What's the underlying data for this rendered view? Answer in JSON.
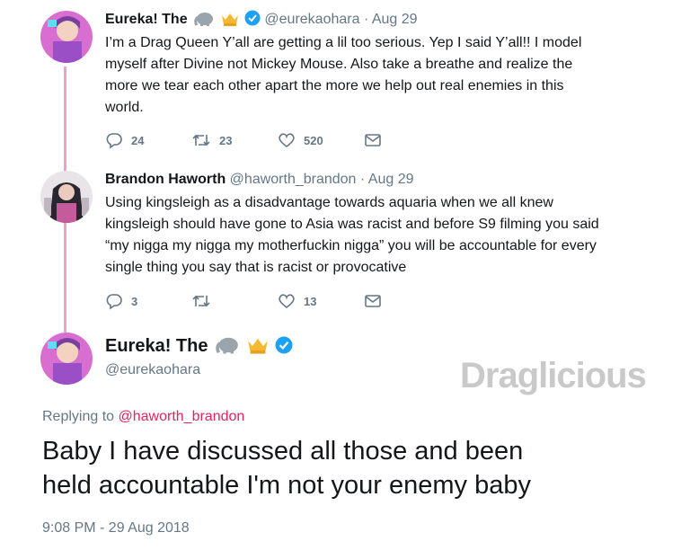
{
  "tweet1": {
    "name": "Eureka! The",
    "handle": "@eurekaohara",
    "separator": "·",
    "date": "Aug 29",
    "lines": [
      "I’m a Drag Queen Y’all are getting a lil too serious. Yep I said Y’all!! I model",
      "myself after Divine not Mickey Mouse. Also take a breathe and realize the",
      "more we tear each other apart the more we help out real enemies in this",
      "world."
    ],
    "replies": "24",
    "retweets": "23",
    "likes": "520"
  },
  "tweet2": {
    "name": "Brandon Haworth",
    "handle": "@haworth_brandon",
    "separator": "·",
    "date": "Aug 29",
    "lines": [
      "Using kingsleigh as a disadvantage towards aquaria when we all knew",
      "kingsleigh should have gone to Asia was racist and before S9 filming you said",
      "“my nigga my nigga my motherfuckin nigga” you will be accountable for every",
      "single thing you say that is racist or provocative"
    ],
    "replies": "3",
    "likes": "13"
  },
  "main": {
    "name": "Eureka! The",
    "handle": "@eurekaohara",
    "replying_prefix": "Replying to",
    "replying_to": "@haworth_brandon",
    "lines": [
      "Baby I have discussed all those and been",
      "held accountable I'm not your enemy baby"
    ],
    "timestamp": "9:08 PM - 29 Aug 2018"
  },
  "watermark": "Draglicious",
  "colors": {
    "thread_line": "#e8a6c6",
    "mention": "#e0245e",
    "verified": "#1da1f2",
    "muted": "#657786"
  }
}
